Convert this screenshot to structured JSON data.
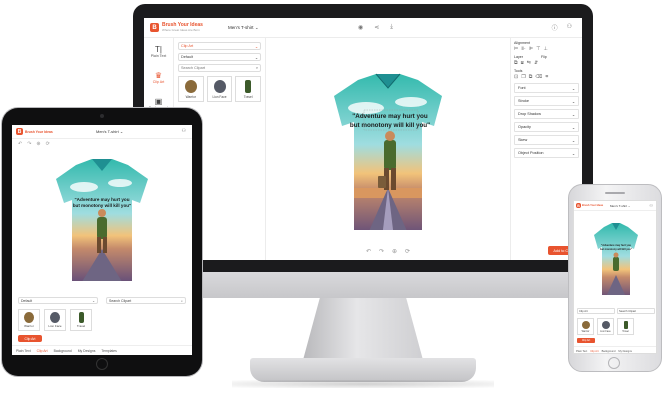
{
  "brand": {
    "name": "Brush Your Ideas",
    "tagline": "Where Great Ideas Are Born",
    "accent": "#e8542f"
  },
  "product": {
    "name": "Men's T-shirt",
    "caret": "⌄"
  },
  "artwork": {
    "quote_line1": "\"Adventure may hurt you",
    "quote_line2": "but monotony will kill you\""
  },
  "desktop": {
    "header_icons": [
      "eye-icon",
      "share-icon",
      "download-icon"
    ],
    "account_icons": [
      "help-icon",
      "user-icon"
    ],
    "sidebar": [
      {
        "icon": "T|",
        "label": "Plain Text",
        "active": false
      },
      {
        "icon": "♛",
        "label": "Clip Art",
        "active": true
      },
      {
        "icon": "▣",
        "label": "Background",
        "active": false
      },
      {
        "icon": "⊞",
        "label": "",
        "active": false
      }
    ],
    "clipart": {
      "category": "Clip Art",
      "subcategory": "Default",
      "search_placeholder": "Search Clipart",
      "items": [
        {
          "label": "Warrior",
          "color": "#8a6a3a"
        },
        {
          "label": "Lion Face",
          "color": "#555a66"
        },
        {
          "label": "Travel",
          "color": "#3c5a2a"
        }
      ]
    },
    "properties": {
      "alignment_label": "Alignment",
      "layer_label": "Layer",
      "flip_label": "Flip",
      "tools_label": "Tools",
      "sections": [
        "Font",
        "Stroke",
        "Drop Shadow",
        "Opacity",
        "Skew",
        "Object Position"
      ]
    },
    "add_to_cart": "Add to Cart"
  },
  "tablet": {
    "category": "Default",
    "search_placeholder": "Search Clipart",
    "items": [
      {
        "label": "Warrior",
        "color": "#8a6a3a"
      },
      {
        "label": "Lion Face",
        "color": "#555a66"
      },
      {
        "label": "Travel",
        "color": "#3c5a2a"
      }
    ],
    "clip_button": "Clip Art",
    "nav": [
      {
        "label": "Plain Text",
        "active": false
      },
      {
        "label": "Clip Art",
        "active": true
      },
      {
        "label": "Background",
        "active": false
      },
      {
        "label": "My Designs",
        "active": false
      },
      {
        "label": "Templates",
        "active": false
      }
    ]
  },
  "phone": {
    "category": "Clip Art",
    "search_placeholder": "Search Clipart",
    "items": [
      {
        "label": "Warrior",
        "color": "#8a6a3a"
      },
      {
        "label": "Lion Face",
        "color": "#555a66"
      },
      {
        "label": "Travel",
        "color": "#3c5a2a"
      }
    ],
    "clip_button": "Clip Art",
    "nav": [
      {
        "label": "Plain Text",
        "active": false
      },
      {
        "label": "Clip Art",
        "active": true
      },
      {
        "label": "Background",
        "active": false
      },
      {
        "label": "My Designs",
        "active": false
      }
    ]
  }
}
